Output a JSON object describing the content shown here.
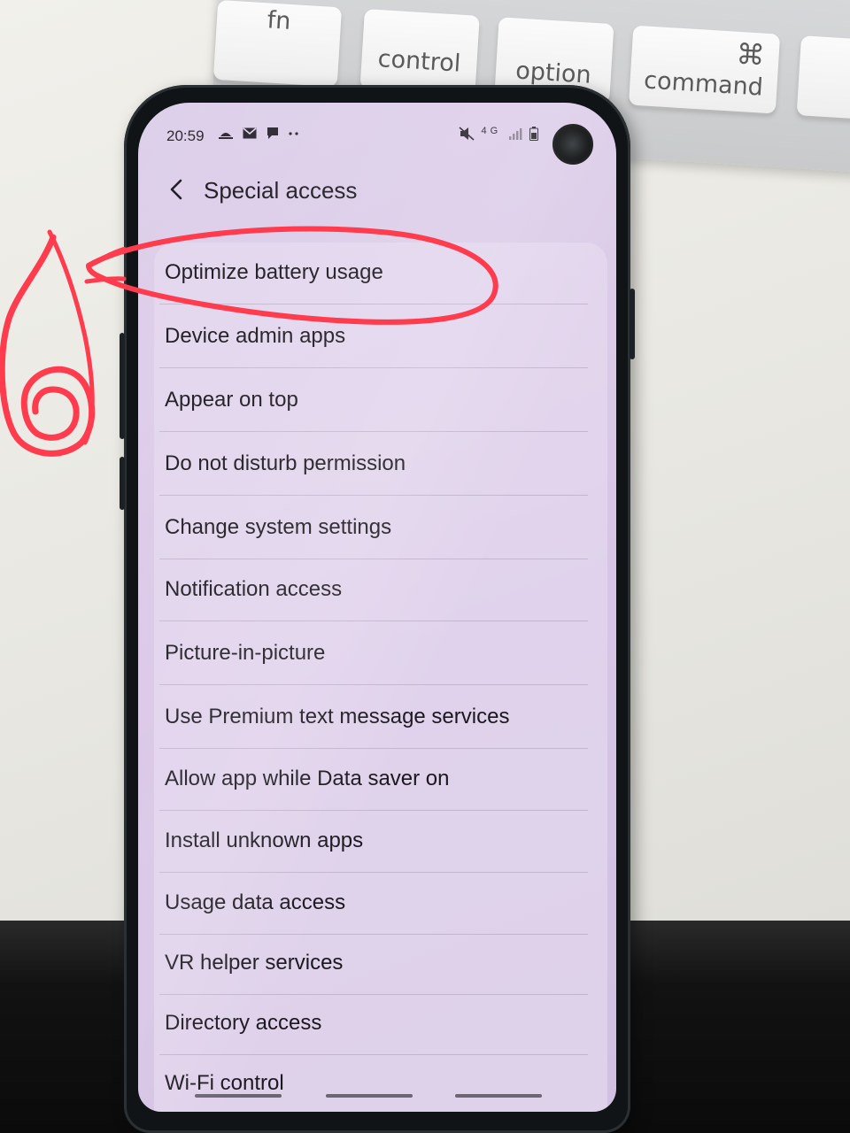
{
  "keyboard": {
    "keys": [
      "fn",
      "control",
      "option",
      "command"
    ],
    "command_symbol": "⌘"
  },
  "status_bar": {
    "time": "20:59",
    "network": "4G"
  },
  "header": {
    "title": "Special access"
  },
  "list": {
    "items": [
      "Optimize battery usage",
      "Device admin apps",
      "Appear on top",
      "Do not disturb permission",
      "Change system settings",
      "Notification access",
      "Picture-in-picture",
      "Use Premium text message services",
      "Allow app while Data saver on",
      "Install unknown apps",
      "Usage data access",
      "VR helper services",
      "Directory access",
      "Wi-Fi control"
    ]
  },
  "annotation": {
    "step_number": "6",
    "highlighted_item": "Optimize battery usage",
    "color": "#ff3b4e"
  }
}
